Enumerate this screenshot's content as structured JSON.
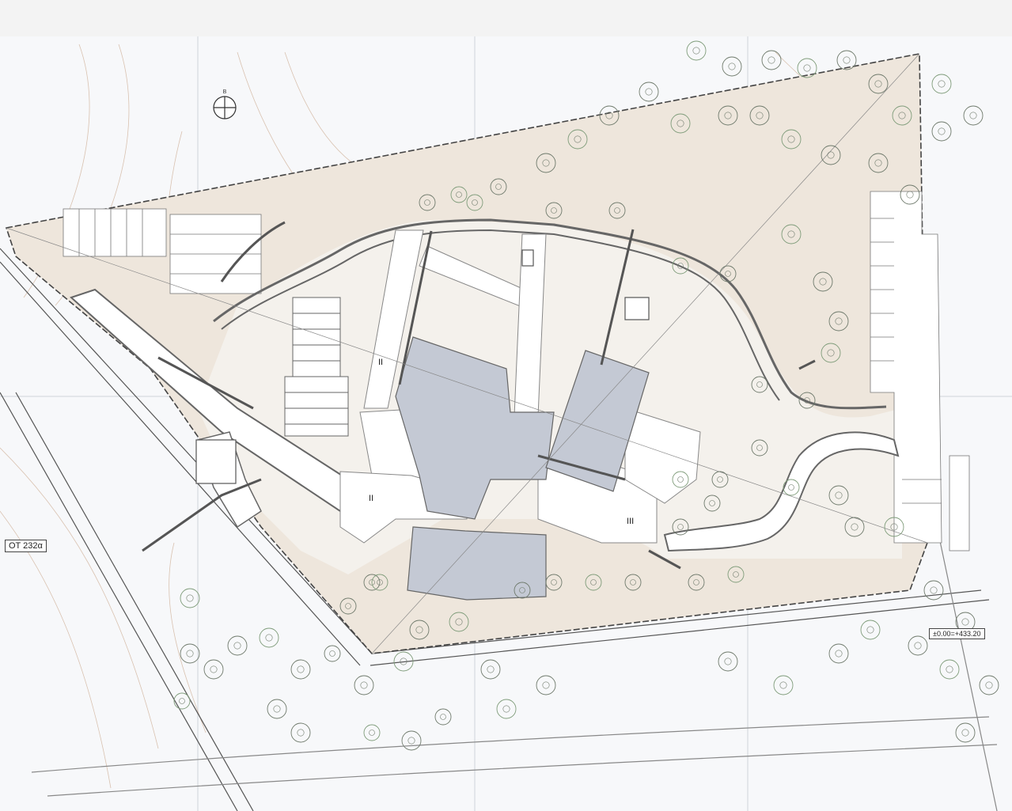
{
  "plan": {
    "block_label": "ΟΤ 232α",
    "elevation_ref": "±0.00=+433.20",
    "building_labels": [
      "II",
      "II",
      "III"
    ],
    "north_label": "B",
    "colors": {
      "paper": "#f7f8fa",
      "site_fill": "#eee6dc",
      "building_fill": "#c4c9d4",
      "wall": "#555555",
      "tree_stroke": "#6f7a6c",
      "green_tree": "#7f9c7a",
      "contour": "#c9a689"
    }
  }
}
